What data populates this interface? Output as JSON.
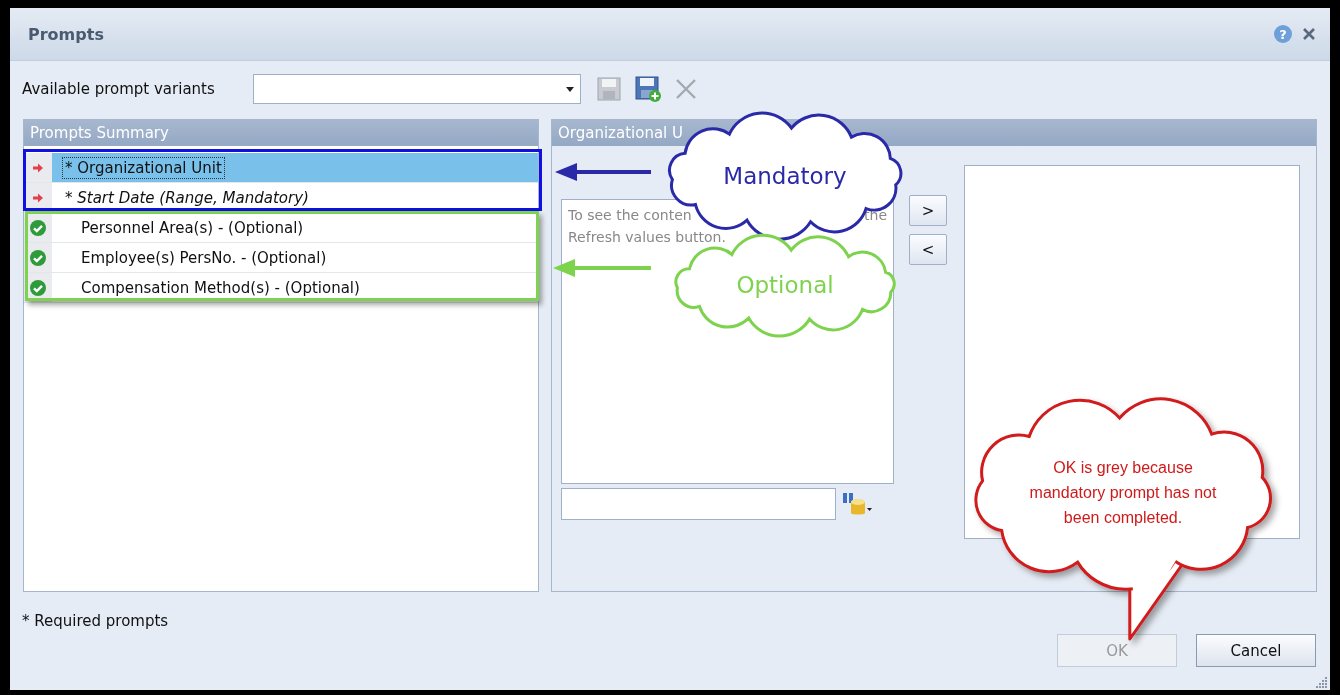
{
  "window": {
    "title": "Prompts",
    "help": "?"
  },
  "variants": {
    "label": "Available prompt variants"
  },
  "summary": {
    "title": "Prompts Summary",
    "items": [
      {
        "kind": "mandatory",
        "label": "* Organizational Unit",
        "selected": true,
        "focused": true,
        "italic": false
      },
      {
        "kind": "mandatory",
        "label": "* Start Date (Range, Mandatory)",
        "selected": false,
        "focused": false,
        "italic": true
      },
      {
        "kind": "optional",
        "label": "Personnel Area(s) - (Optional)",
        "selected": false,
        "focused": false,
        "italic": false
      },
      {
        "kind": "optional",
        "label": "Employee(s) PersNo. - (Optional)",
        "selected": false,
        "focused": false,
        "italic": false
      },
      {
        "kind": "optional",
        "label": "Compensation Method(s) - (Optional)",
        "selected": false,
        "focused": false,
        "italic": false
      }
    ]
  },
  "detail": {
    "title": "Organizational U",
    "hint_start": "To see the conten",
    "hint_end": "the",
    "hint_line2": "Refresh values button.",
    "add_button": ">",
    "remove_button": "<"
  },
  "footer": {
    "note": "* Required prompts",
    "buttons": [
      {
        "label": "OK",
        "disabled": true
      },
      {
        "label": "Cancel",
        "disabled": false
      }
    ]
  },
  "annotations": [
    {
      "kind": "cloud",
      "text": "Mandatory",
      "color": "#2a2aa8"
    },
    {
      "kind": "cloud",
      "text": "Optional",
      "color": "#7ed34e"
    },
    {
      "kind": "speech",
      "text": "OK is grey because mandatory prompt has not been completed.",
      "color": "#d01a1a"
    }
  ]
}
